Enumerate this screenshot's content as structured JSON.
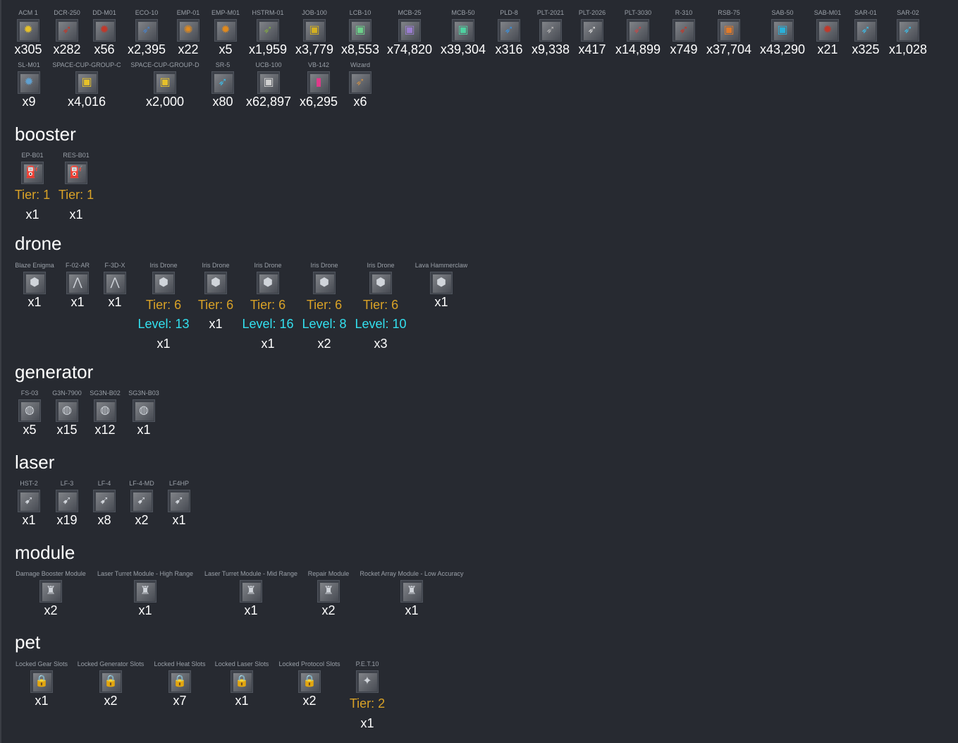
{
  "top_row": [
    {
      "label": "ACM 1",
      "qty": "x305",
      "icon": "mine-icon",
      "color": "#e6c12a"
    },
    {
      "label": "DCR-250",
      "qty": "x282",
      "icon": "rocket-icon",
      "color": "#c0392b"
    },
    {
      "label": "DD-M01",
      "qty": "x56",
      "icon": "mine-icon",
      "color": "#c0392b"
    },
    {
      "label": "ECO-10",
      "qty": "x2,395",
      "icon": "rocket-icon",
      "color": "#4a7fc1"
    },
    {
      "label": "EMP-01",
      "qty": "x22",
      "icon": "emp-icon",
      "color": "#e08a1e"
    },
    {
      "label": "EMP-M01",
      "qty": "x5",
      "icon": "mine-icon",
      "color": "#e08a1e"
    },
    {
      "label": "HSTRM-01",
      "qty": "x1,959",
      "icon": "rocket-icon",
      "color": "#7fa347"
    },
    {
      "label": "JOB-100",
      "qty": "x3,779",
      "icon": "ammo-box-icon",
      "color": "#d4b020"
    },
    {
      "label": "LCB-10",
      "qty": "x8,553",
      "icon": "ammo-box-icon",
      "color": "#6dd08a"
    },
    {
      "label": "MCB-25",
      "qty": "x74,820",
      "icon": "ammo-box-icon",
      "color": "#9a7dd0"
    },
    {
      "label": "MCB-50",
      "qty": "x39,304",
      "icon": "ammo-box-icon",
      "color": "#4fd0a0"
    },
    {
      "label": "PLD-8",
      "qty": "x316",
      "icon": "rocket-icon",
      "color": "#3d8fd8"
    },
    {
      "label": "PLT-2021",
      "qty": "x9,338",
      "icon": "rocket-icon",
      "color": "#b0b0b0"
    },
    {
      "label": "PLT-2026",
      "qty": "x417",
      "icon": "rocket-icon",
      "color": "#d0d0d0"
    },
    {
      "label": "PLT-3030",
      "qty": "x14,899",
      "icon": "rocket-icon",
      "color": "#c04a4a"
    },
    {
      "label": "R-310",
      "qty": "x749",
      "icon": "rocket-icon",
      "color": "#c0392b"
    },
    {
      "label": "RSB-75",
      "qty": "x37,704",
      "icon": "ammo-box-icon",
      "color": "#e07a2a"
    },
    {
      "label": "SAB-50",
      "qty": "x43,290",
      "icon": "ammo-box-icon",
      "color": "#2ab0d8"
    },
    {
      "label": "SAB-M01",
      "qty": "x21",
      "icon": "mine-icon",
      "color": "#c0392b"
    },
    {
      "label": "SAR-01",
      "qty": "x325",
      "icon": "rocket-icon",
      "color": "#3fb8e0"
    },
    {
      "label": "SAR-02",
      "qty": "x1,028",
      "icon": "rocket-icon",
      "color": "#3fb8e0"
    }
  ],
  "second_row": [
    {
      "label": "SL-M01",
      "qty": "x9",
      "icon": "mine-icon",
      "color": "#5fa0d0"
    },
    {
      "label": "SPACE-CUP-GROUP-C",
      "qty": "x4,016",
      "icon": "ammo-box-icon",
      "color": "#e6c12a"
    },
    {
      "label": "SPACE-CUP-GROUP-D",
      "qty": "x2,000",
      "icon": "ammo-box-icon",
      "color": "#e6c12a"
    },
    {
      "label": "SR-5",
      "qty": "x80",
      "icon": "rocket-icon",
      "color": "#3fb8e0"
    },
    {
      "label": "UCB-100",
      "qty": "x62,897",
      "icon": "ammo-box-icon",
      "color": "#d0d0d0"
    },
    {
      "label": "VB-142",
      "qty": "x6,295",
      "icon": "battery-icon",
      "color": "#e03a8a"
    },
    {
      "label": "Wizard",
      "qty": "x6",
      "icon": "rocket-icon",
      "color": "#c08a4a"
    }
  ],
  "sections": {
    "booster": {
      "title": "booster",
      "items": [
        {
          "label": "EP-B01",
          "tier": "Tier: 1",
          "qty": "x1",
          "icon": "booster-icon"
        },
        {
          "label": "RES-B01",
          "tier": "Tier: 1",
          "qty": "x1",
          "icon": "booster-icon"
        }
      ]
    },
    "drone": {
      "title": "drone",
      "items": [
        {
          "label": "Blaze Enigma",
          "qty": "x1",
          "icon": "drone-icon"
        },
        {
          "label": "F-02-AR",
          "qty": "x1",
          "icon": "drone-formation-icon"
        },
        {
          "label": "F-3D-X",
          "qty": "x1",
          "icon": "drone-formation-icon"
        },
        {
          "label": "Iris Drone",
          "tier": "Tier: 6",
          "level": "Level: 13",
          "qty": "x1",
          "icon": "drone-icon"
        },
        {
          "label": "Iris Drone",
          "tier": "Tier: 6",
          "qty": "x1",
          "icon": "drone-icon"
        },
        {
          "label": "Iris Drone",
          "tier": "Tier: 6",
          "level": "Level: 16",
          "qty": "x1",
          "icon": "drone-icon"
        },
        {
          "label": "Iris Drone",
          "tier": "Tier: 6",
          "level": "Level: 8",
          "qty": "x2",
          "icon": "drone-icon"
        },
        {
          "label": "Iris Drone",
          "tier": "Tier: 6",
          "level": "Level: 10",
          "qty": "x3",
          "icon": "drone-icon"
        },
        {
          "label": "Lava Hammerclaw",
          "qty": "x1",
          "icon": "drone-icon"
        }
      ]
    },
    "generator": {
      "title": "generator",
      "items": [
        {
          "label": "FS-03",
          "qty": "x5",
          "icon": "generator-icon"
        },
        {
          "label": "G3N-7900",
          "qty": "x15",
          "icon": "generator-icon"
        },
        {
          "label": "SG3N-B02",
          "qty": "x12",
          "icon": "generator-icon"
        },
        {
          "label": "SG3N-B03",
          "qty": "x1",
          "icon": "generator-icon"
        }
      ]
    },
    "laser": {
      "title": "laser",
      "items": [
        {
          "label": "HST-2",
          "qty": "x1",
          "icon": "laser-icon"
        },
        {
          "label": "LF-3",
          "qty": "x19",
          "icon": "laser-icon"
        },
        {
          "label": "LF-4",
          "qty": "x8",
          "icon": "laser-icon"
        },
        {
          "label": "LF-4-MD",
          "qty": "x2",
          "icon": "laser-icon"
        },
        {
          "label": "LF4HP",
          "qty": "x1",
          "icon": "laser-icon"
        }
      ]
    },
    "module": {
      "title": "module",
      "items": [
        {
          "label": "Damage Booster Module",
          "qty": "x2",
          "icon": "module-icon"
        },
        {
          "label": "Laser Turret Module - High Range",
          "qty": "x1",
          "icon": "module-icon"
        },
        {
          "label": "Laser Turret Module - Mid Range",
          "qty": "x1",
          "icon": "module-icon"
        },
        {
          "label": "Repair Module",
          "qty": "x2",
          "icon": "module-icon"
        },
        {
          "label": "Rocket Array Module - Low Accuracy",
          "qty": "x1",
          "icon": "module-icon"
        }
      ]
    },
    "pet": {
      "title": "pet",
      "items": [
        {
          "label": "Locked Gear Slots",
          "qty": "x1",
          "icon": "lock-icon"
        },
        {
          "label": "Locked Generator Slots",
          "qty": "x2",
          "icon": "lock-icon"
        },
        {
          "label": "Locked Heat Slots",
          "qty": "x7",
          "icon": "lock-icon"
        },
        {
          "label": "Locked Laser Slots",
          "qty": "x1",
          "icon": "lock-icon"
        },
        {
          "label": "Locked Protocol Slots",
          "qty": "x2",
          "icon": "lock-icon"
        },
        {
          "label": "P.E.T.10",
          "tier": "Tier: 2",
          "qty": "x1",
          "icon": "pet-icon"
        }
      ]
    }
  }
}
